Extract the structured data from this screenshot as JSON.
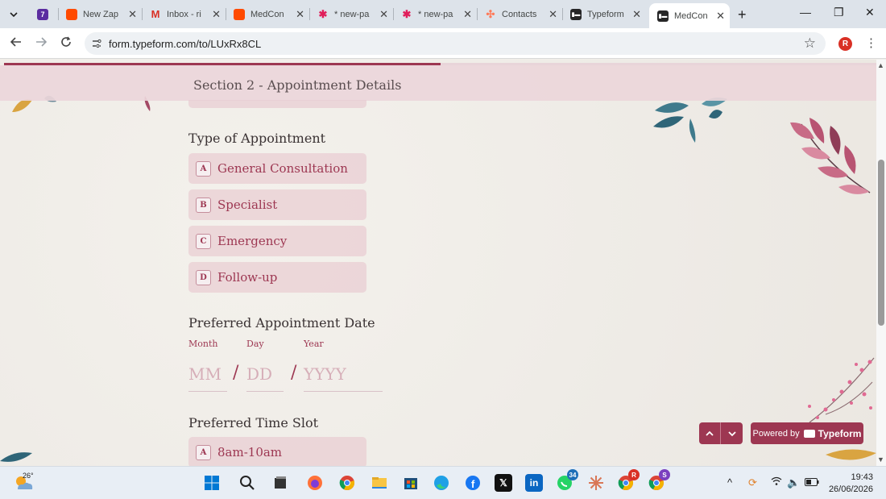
{
  "browser": {
    "tabs": [
      {
        "title": "",
        "favicon": "7"
      },
      {
        "title": "New Zap"
      },
      {
        "title": "Inbox - ri"
      },
      {
        "title": "MedCon"
      },
      {
        "title": "* new-pa"
      },
      {
        "title": "* new-pa"
      },
      {
        "title": "Contacts"
      },
      {
        "title": "Typeform"
      },
      {
        "title": "MedCon",
        "active": true
      }
    ],
    "url": "form.typeform.com/to/LUxRx8CL",
    "profile_initial": "R"
  },
  "form": {
    "section_title": "Section 2 - Appointment Details",
    "progress_percent": 50,
    "questions": {
      "appointment_type": {
        "label": "Type of Appointment",
        "choices": [
          {
            "key": "A",
            "text": "General Consultation"
          },
          {
            "key": "B",
            "text": "Specialist"
          },
          {
            "key": "C",
            "text": "Emergency"
          },
          {
            "key": "D",
            "text": "Follow-up"
          }
        ]
      },
      "preferred_date": {
        "label": "Preferred Appointment Date",
        "month_label": "Month",
        "day_label": "Day",
        "year_label": "Year",
        "month_placeholder": "MM",
        "day_placeholder": "DD",
        "year_placeholder": "YYYY",
        "separator": "/"
      },
      "time_slot": {
        "label": "Preferred Time Slot",
        "choices": [
          {
            "key": "A",
            "text": "8am-10am"
          }
        ]
      }
    },
    "powered_by": "Powered by",
    "brand": "Typeform",
    "accent_color": "#9d3752"
  },
  "taskbar": {
    "weather_temp": "26°",
    "whatsapp_badge": "34",
    "chrome_badge_1": "R",
    "chrome_badge_2": "S",
    "time": "19:43",
    "date": "26/06/2026"
  }
}
